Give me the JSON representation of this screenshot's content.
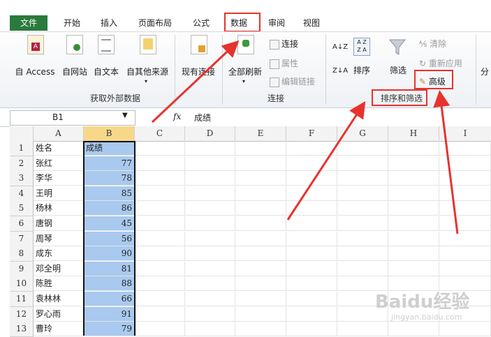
{
  "tabs": {
    "file": "文件",
    "items": [
      "开始",
      "插入",
      "页面布局",
      "公式",
      "数据",
      "审阅",
      "视图"
    ],
    "active": "数据"
  },
  "ribbon": {
    "external_data": {
      "buttons": [
        "自 Access",
        "自网站",
        "自文本",
        "自其他来源",
        "现有连接"
      ],
      "label": "获取外部数据"
    },
    "connections": {
      "refresh_all": "全部刷新",
      "connections": "连接",
      "properties": "属性",
      "edit_links": "编辑链接",
      "label": "连接"
    },
    "sort_filter": {
      "sort_az": "A↓Z",
      "sort_za": "Z↓A",
      "sort": "排序",
      "filter": "筛选",
      "clear": "清除",
      "reapply": "重新应用",
      "advanced": "高级",
      "label": "排序和筛选"
    },
    "partial_group": "分"
  },
  "formula_bar": {
    "name_box": "B1",
    "fx": "fx",
    "content": "成绩"
  },
  "grid": {
    "columns": [
      "A",
      "B",
      "C",
      "D",
      "E",
      "F",
      "G",
      "H",
      "I"
    ],
    "rows": [
      {
        "n": "1",
        "a": "姓名",
        "b": "成绩"
      },
      {
        "n": "2",
        "a": "张红",
        "b": "77"
      },
      {
        "n": "3",
        "a": "李华",
        "b": "78"
      },
      {
        "n": "4",
        "a": "王明",
        "b": "85"
      },
      {
        "n": "5",
        "a": "杨林",
        "b": "86"
      },
      {
        "n": "6",
        "a": "唐钢",
        "b": "45"
      },
      {
        "n": "7",
        "a": "周琴",
        "b": "56"
      },
      {
        "n": "8",
        "a": "成东",
        "b": "90"
      },
      {
        "n": "9",
        "a": "邓全明",
        "b": "81"
      },
      {
        "n": "10",
        "a": "陈胜",
        "b": "88"
      },
      {
        "n": "11",
        "a": "袁林林",
        "b": "66"
      },
      {
        "n": "12",
        "a": "罗心雨",
        "b": "91"
      },
      {
        "n": "13",
        "a": "曹玲",
        "b": "79"
      }
    ]
  },
  "watermark": {
    "brand": "Baidu经验",
    "url": "jingyan.baidu.com"
  },
  "colors": {
    "file_tab": "#2b7a3d",
    "highlight": "#e8322e",
    "selection": "#a9c9ee"
  }
}
